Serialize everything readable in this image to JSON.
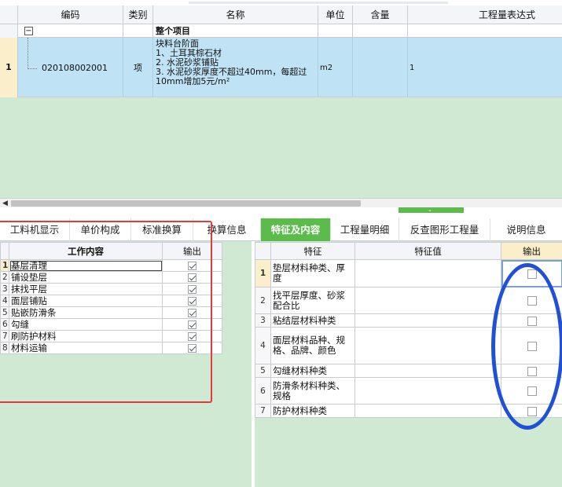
{
  "top_grid": {
    "headers": {
      "code": "编码",
      "type": "类别",
      "name": "名称",
      "unit": "单位",
      "content": "含量",
      "expression": "工程量表达式"
    },
    "group_row": {
      "toggle": "−",
      "label": "整个项目"
    },
    "item": {
      "row_number": "1",
      "code": "020108002001",
      "type": "项",
      "name_lines": [
        "块料台阶面",
        "1、土耳其棕石材",
        "2. 水泥砂浆铺贴",
        "3. 水泥砂浆厚度不超过40mm，每超过",
        "10mm增加5元/m²"
      ],
      "unit": "m2",
      "content": "",
      "expression": "1"
    }
  },
  "scroll": {
    "left_arrow": "◀",
    "splitter_arrow": "⌄"
  },
  "tabs": [
    {
      "label": "工料机显示"
    },
    {
      "label": "单价构成"
    },
    {
      "label": "标准换算"
    },
    {
      "label": "换算信息"
    },
    {
      "label": "特征及内容"
    },
    {
      "label": "工程量明细"
    },
    {
      "label": "反查图形工程量"
    },
    {
      "label": "说明信息"
    }
  ],
  "active_tab": "特征及内容",
  "work_content": {
    "header_content": "工作内容",
    "header_output": "输出",
    "rows": [
      {
        "num": "1",
        "label": "基层清理",
        "output": true
      },
      {
        "num": "2",
        "label": "铺设垫层",
        "output": true
      },
      {
        "num": "3",
        "label": "抹找平层",
        "output": true
      },
      {
        "num": "4",
        "label": "面层铺贴",
        "output": true
      },
      {
        "num": "5",
        "label": "贴嵌防滑条",
        "output": true
      },
      {
        "num": "6",
        "label": "勾缝",
        "output": true
      },
      {
        "num": "7",
        "label": "刷防护材料",
        "output": true
      },
      {
        "num": "8",
        "label": "材料运输",
        "output": true
      }
    ]
  },
  "features": {
    "header_feature": "特征",
    "header_value": "特征值",
    "header_output": "输出",
    "rows": [
      {
        "num": "1",
        "label": "垫层材料种类、厚度",
        "value": "",
        "output": false
      },
      {
        "num": "2",
        "label": "找平层厚度、砂浆配合比",
        "value": "",
        "output": false
      },
      {
        "num": "3",
        "label": "粘结层材料种类",
        "value": "",
        "output": false
      },
      {
        "num": "4",
        "label": "面层材料品种、规格、品牌、颜色",
        "value": "",
        "output": false
      },
      {
        "num": "5",
        "label": "勾缝材料种类",
        "value": "",
        "output": false
      },
      {
        "num": "6",
        "label": "防滑条材料种类、规格",
        "value": "",
        "output": false
      },
      {
        "num": "7",
        "label": "防护材料种类",
        "value": "",
        "output": false
      }
    ]
  },
  "colors": {
    "active_tab": "#5cbc4b",
    "panel_background": "#cfe9d2",
    "selected_row": "#bfe3f5",
    "annotation_rect": "#e23b3b",
    "annotation_ellipse": "#2050d6"
  }
}
